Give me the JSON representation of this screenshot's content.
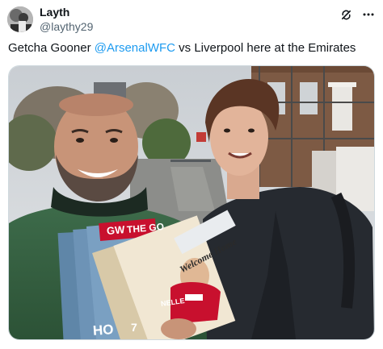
{
  "author": {
    "display_name": "Layth",
    "handle": "@laythy29"
  },
  "tweet": {
    "text_before": "Getcha Gooner ",
    "mention": "@ArsenalWFC",
    "text_after": " vs Liverpool here at the Emirates"
  },
  "icons": {
    "top_left_action": "grok-icon",
    "more": "more-horizontal-icon"
  },
  "media": {
    "programme_brand": "GW",
    "programme_masthead": "THE GO",
    "programme_cover_line": "Welcome Home",
    "programme_shirt_name": "NELLE",
    "programme_shirt_number": "7",
    "programme_bottom_text": "HO"
  },
  "colors": {
    "accent": "#1d9bf0",
    "text": "#0f1419",
    "muted": "#536471",
    "programme_red": "#c8102e"
  }
}
